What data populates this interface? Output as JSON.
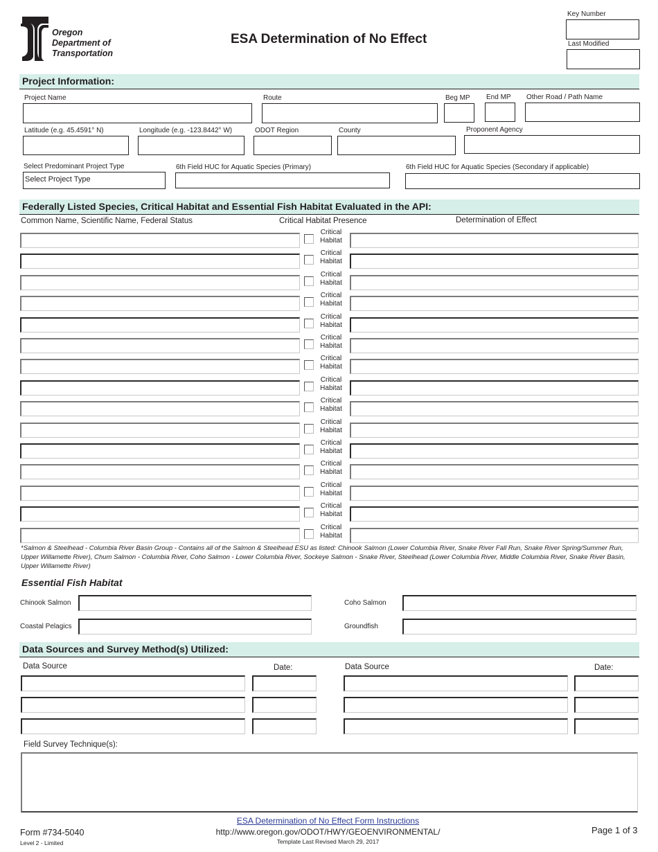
{
  "header": {
    "logo_lines": [
      "Oregon",
      "Department of",
      "Transportation"
    ],
    "title": "ESA Determination of No Effect",
    "key_number_label": "Key Number",
    "key_number_value": "",
    "last_modified_label": "Last Modified",
    "last_modified_value": ""
  },
  "project_info": {
    "section_title": "Project Information:",
    "fields": {
      "project_name": {
        "label": "Project Name",
        "value": ""
      },
      "route": {
        "label": "Route",
        "value": ""
      },
      "beg_mp": {
        "label": "Beg MP",
        "value": ""
      },
      "end_mp": {
        "label": "End MP",
        "value": ""
      },
      "other_road": {
        "label": "Other Road / Path Name",
        "value": ""
      },
      "latitude": {
        "label": "Latitude (e.g. 45.4591° N)",
        "value": ""
      },
      "longitude": {
        "label": "Longitude (e.g. -123.8442° W)",
        "value": ""
      },
      "odot_region": {
        "label": "ODOT Region",
        "value": ""
      },
      "county": {
        "label": "County",
        "value": ""
      },
      "proponent_agency": {
        "label": "Proponent Agency",
        "value": ""
      },
      "project_type": {
        "label": "Select Predominant Project Type",
        "value": "Select Project Type"
      },
      "huc_primary": {
        "label": "6th Field HUC for Aquatic Species (Primary)",
        "value": ""
      },
      "huc_secondary": {
        "label": "6th Field HUC  for Aquatic Species (Secondary if applicable)",
        "value": ""
      }
    }
  },
  "species": {
    "section_title": "Federally Listed Species, Critical Habitat and Essential Fish Habitat Evaluated in the API:",
    "columns": [
      "Common Name,  Scientific Name,  Federal Status",
      "Critical Habitat Presence",
      "Determination of Effect"
    ],
    "checkbox_label_line1": "Critical",
    "checkbox_label_line2": "Habitat",
    "rows": [
      {
        "name": "",
        "critical_habitat": false,
        "determination": ""
      },
      {
        "name": "",
        "critical_habitat": false,
        "determination": ""
      },
      {
        "name": "",
        "critical_habitat": false,
        "determination": ""
      },
      {
        "name": "",
        "critical_habitat": false,
        "determination": ""
      },
      {
        "name": "",
        "critical_habitat": false,
        "determination": ""
      },
      {
        "name": "",
        "critical_habitat": false,
        "determination": ""
      },
      {
        "name": "",
        "critical_habitat": false,
        "determination": ""
      },
      {
        "name": "",
        "critical_habitat": false,
        "determination": ""
      },
      {
        "name": "",
        "critical_habitat": false,
        "determination": ""
      },
      {
        "name": "",
        "critical_habitat": false,
        "determination": ""
      },
      {
        "name": "",
        "critical_habitat": false,
        "determination": ""
      },
      {
        "name": "",
        "critical_habitat": false,
        "determination": ""
      },
      {
        "name": "",
        "critical_habitat": false,
        "determination": ""
      },
      {
        "name": "",
        "critical_habitat": false,
        "determination": ""
      },
      {
        "name": "",
        "critical_habitat": false,
        "determination": ""
      }
    ],
    "footnote": "*Salmon & Steelhead - Columbia River Basin Group - Contains all of the Salmon & Steelhead ESU as listed: Chinook Salmon (Lower Columbia River, Snake River Fall Run, Snake River Spring/Summer Run, Upper Willamette River), Chum Salmon - Columbia River, Coho Salmon - Lower Columbia River, Sockeye Salmon - Snake River, Steelhead (Lower Columbia River, Middle Columbia River, Snake River Basin, Upper Willamette River)"
  },
  "efh": {
    "title": "Essential Fish Habitat",
    "fields": [
      {
        "label": "Chinook Salmon",
        "value": ""
      },
      {
        "label": "Coho Salmon",
        "value": ""
      },
      {
        "label": "Coastal Pelagics",
        "value": ""
      },
      {
        "label": "Groundfish",
        "value": ""
      }
    ]
  },
  "data_sources": {
    "section_title": "Data Sources and Survey Method(s) Utilized:",
    "source_label": "Data Source",
    "date_label": "Date:",
    "left_rows": [
      {
        "source": "",
        "date": ""
      },
      {
        "source": "",
        "date": ""
      },
      {
        "source": "",
        "date": ""
      }
    ],
    "right_rows": [
      {
        "source": "",
        "date": ""
      },
      {
        "source": "",
        "date": ""
      },
      {
        "source": "",
        "date": ""
      }
    ],
    "field_survey_label": "Field Survey Technique(s):",
    "field_survey_value": ""
  },
  "footer": {
    "form_number": "Form #734-5040",
    "level": "Level 2 - Limited",
    "instructions_link": "ESA Determination of No Effect Form Instructions",
    "url": "http://www.oregon.gov/ODOT/HWY/GEOENVIRONMENTAL/",
    "revised": "Template Last Revised March 29, 2017",
    "page": "Page 1 of 3"
  },
  "colors": {
    "section_bar": "#d6efe8",
    "link": "#2b3a94",
    "text": "#231f20"
  }
}
